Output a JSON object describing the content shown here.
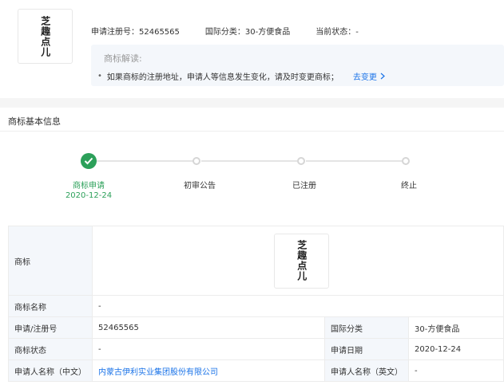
{
  "header": {
    "logo_text": "芝趣点儿",
    "reg_no_label": "申请注册号：",
    "reg_no_value": "52465565",
    "intl_class_label": "国际分类：",
    "intl_class_value": "30-方便食品",
    "status_label": "当前状态：",
    "status_value": "-"
  },
  "interpretation": {
    "title": "商标解读:",
    "bullet": "•",
    "text": "如果商标的注册地址，申请人等信息发生变化，请及时变更商标；",
    "link_label": "去变更",
    "link_icon": "chevron-right-icon"
  },
  "section": {
    "title": "商标基本信息"
  },
  "timeline": {
    "steps": [
      {
        "label": "商标申请",
        "date": "2020-12-24",
        "state": "done"
      },
      {
        "label": "初审公告",
        "date": "",
        "state": "pending"
      },
      {
        "label": "已注册",
        "date": "",
        "state": "pending"
      },
      {
        "label": "终止",
        "date": "",
        "state": "pending"
      }
    ]
  },
  "table": {
    "mark_label": "商标",
    "mark_image_text": "芝趣点儿",
    "name_label": "商标名称",
    "name_value": "-",
    "reg_no_label": "申请/注册号",
    "reg_no_value": "52465565",
    "intl_class_label": "国际分类",
    "intl_class_value": "30-方便食品",
    "status_label": "商标状态",
    "status_value": "-",
    "date_label": "申请日期",
    "date_value": "2020-12-24",
    "applicant_cn_label": "申请人名称（中文）",
    "applicant_cn_value": "内蒙古伊利实业集团股份有限公司",
    "applicant_en_label": "申请人名称（英文）",
    "applicant_en_value": "-"
  },
  "colors": {
    "accent_green": "#2ca05a",
    "link_blue": "#1a73e8",
    "label_bg": "#f4f7fb"
  }
}
